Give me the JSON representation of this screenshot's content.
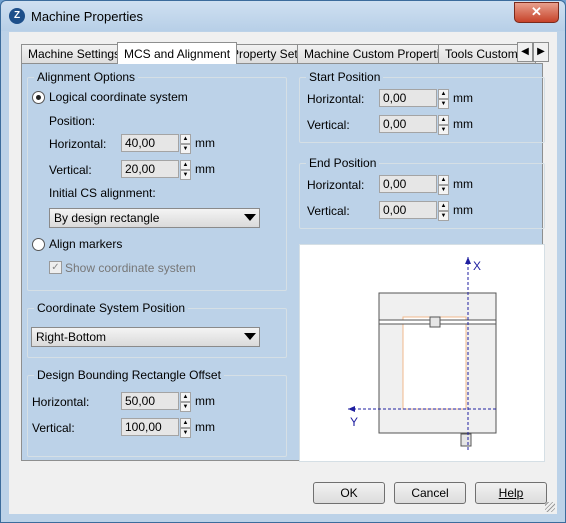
{
  "window": {
    "title": "Machine Properties",
    "close_glyph": "✕",
    "app_icon_glyph": "Z"
  },
  "tabs": [
    {
      "label": "Machine Settings"
    },
    {
      "label": "MCS and Alignment"
    },
    {
      "label": "Property Sets"
    },
    {
      "label": "Machine Custom Properties"
    },
    {
      "label": "Tools Custom P"
    }
  ],
  "tab_scroll": {
    "left": "◀",
    "right": "▶"
  },
  "alignment": {
    "title": "Alignment Options",
    "logical_label": "Logical coordinate system",
    "logical_selected": true,
    "position_label": "Position:",
    "horizontal_label": "Horizontal:",
    "horizontal_value": "40,00",
    "vertical_label": "Vertical:",
    "vertical_value": "20,00",
    "unit": "mm",
    "initial_label": "Initial CS alignment:",
    "initial_value": "By design rectangle",
    "align_markers_label": "Align markers",
    "align_markers_selected": false,
    "show_cs_label": "Show coordinate system",
    "show_cs_checked": true
  },
  "cs_position": {
    "title": "Coordinate System Position",
    "value": "Right-Bottom"
  },
  "offset": {
    "title": "Design Bounding Rectangle Offset",
    "horizontal_label": "Horizontal:",
    "horizontal_value": "50,00",
    "vertical_label": "Vertical:",
    "vertical_value": "100,00",
    "unit": "mm"
  },
  "start_position": {
    "title": "Start Position",
    "horizontal_label": "Horizontal:",
    "horizontal_value": "0,00",
    "vertical_label": "Vertical:",
    "vertical_value": "0,00",
    "unit": "mm"
  },
  "end_position": {
    "title": "End Position",
    "horizontal_label": "Horizontal:",
    "horizontal_value": "0,00",
    "vertical_label": "Vertical:",
    "vertical_value": "0,00",
    "unit": "mm"
  },
  "preview": {
    "x_axis_label": "X",
    "y_axis_label": "Y",
    "axis_color": "#1f1fa0",
    "design_color": "#f0b88c"
  },
  "buttons": {
    "ok": "OK",
    "cancel": "Cancel",
    "help": "Help"
  }
}
